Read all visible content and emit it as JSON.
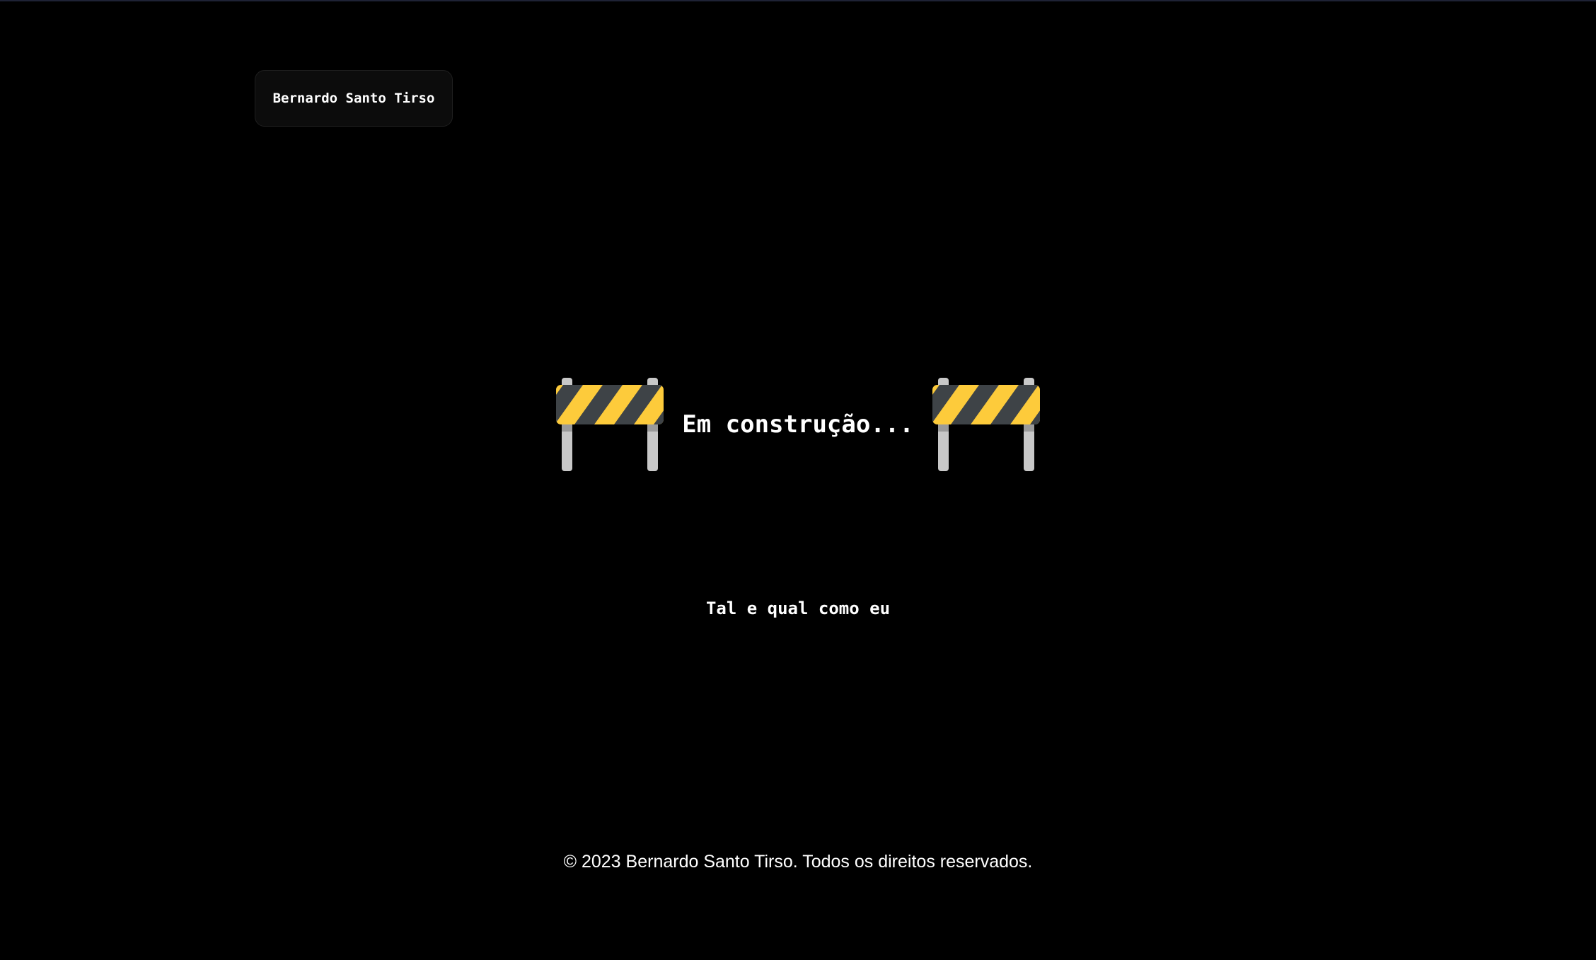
{
  "header": {
    "brand_label": "Bernardo Santo Tirso"
  },
  "hero": {
    "title": "Em construção...",
    "left_icon": "construction-barrier-icon",
    "right_icon": "construction-barrier-icon"
  },
  "tagline": "Tal e qual como eu",
  "footer": {
    "copyright": "© 2023 Bernardo Santo Tirso. Todos os direitos reservados."
  },
  "colors": {
    "background": "#000000",
    "text": "#ffffff",
    "chip_background": "#0c0c0c",
    "barrier_yellow": "#fdcb3b",
    "barrier_dark": "#3e4347",
    "barrier_post": "#c8c8c8"
  }
}
